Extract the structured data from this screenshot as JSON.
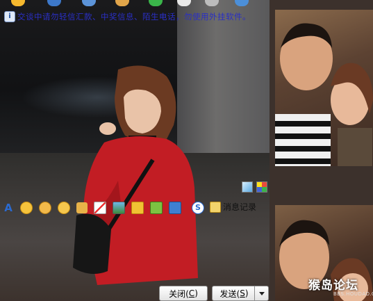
{
  "notice": {
    "text": "交谈中请勿轻信汇款、中奖信息、陌生电话，勿使用外挂软件。"
  },
  "history": {
    "label": "消息记录"
  },
  "buttons": {
    "close": "关闭(",
    "close_key": "C",
    "close_end": ")",
    "send": "发送(",
    "send_key": "S",
    "send_end": ")"
  },
  "watermark": {
    "main": "猴岛论坛",
    "sub": "BBS.HOUDAO.COM"
  },
  "toolbar_icons": [
    "smiley-icon",
    "search-icon",
    "calendar-icon",
    "paste-icon",
    "add-icon",
    "doc-icon",
    "gear-icon",
    "ie-icon"
  ],
  "emoticon_icons": [
    "font-icon",
    "smile-icon",
    "angry-icon",
    "wink-icon",
    "thumb-icon",
    "pencil-icon",
    "picture-icon",
    "gift-icon",
    "puzzle-icon",
    "screen-icon",
    "s-icon"
  ],
  "colors": {
    "notice_text": "#2a2fc4",
    "background": "#3c312c"
  }
}
